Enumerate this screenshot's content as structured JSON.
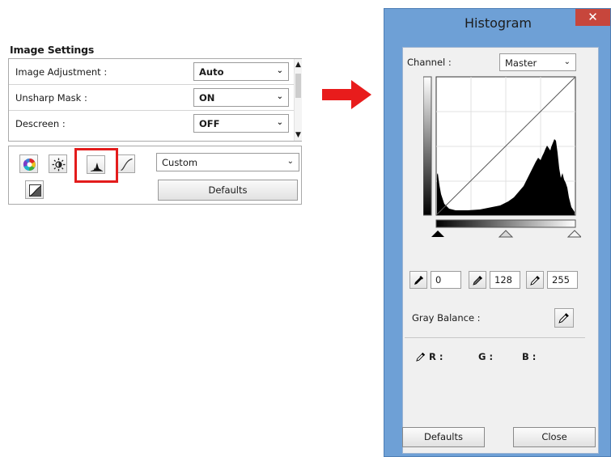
{
  "image_settings": {
    "title": "Image Settings",
    "rows": [
      {
        "label": "Image Adjustment :",
        "value": "Auto"
      },
      {
        "label": "Unsharp Mask :",
        "value": "ON"
      },
      {
        "label": "Descreen :",
        "value": "OFF"
      }
    ],
    "tone_preset": "Custom",
    "defaults_label": "Defaults",
    "tool_icons": [
      "color-balance-icon",
      "brightness-contrast-icon",
      "histogram-icon",
      "tone-curve-icon",
      "threshold-icon"
    ]
  },
  "histogram_dialog": {
    "title": "Histogram",
    "close_glyph": "✕",
    "channel_label": "Channel :",
    "channel_value": "Master",
    "shadow_value": "0",
    "mid_value": "128",
    "highlight_value": "255",
    "gray_balance_label": "Gray Balance :",
    "r_label": "R :",
    "g_label": "G :",
    "b_label": "B :",
    "defaults_label": "Defaults",
    "close_label": "Close"
  },
  "colors": {
    "dialog_frame": "#6ea0d6",
    "close_button": "#c7463c",
    "highlight_red": "#e31c1c",
    "arrow_red": "#e81c1c"
  }
}
